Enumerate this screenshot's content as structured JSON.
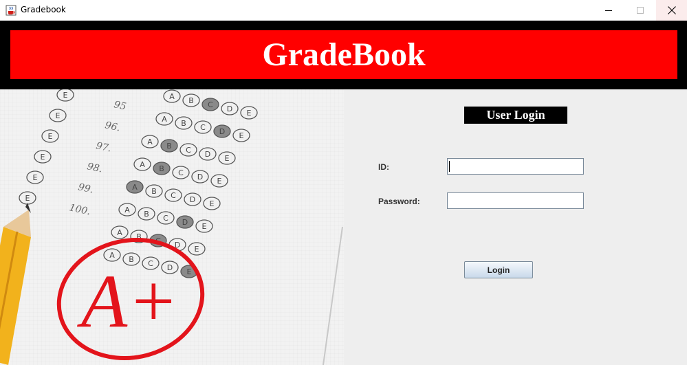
{
  "window": {
    "title": "Gradebook",
    "close_hover_color": "#fbecec"
  },
  "header": {
    "title": "GradeBook",
    "background": "#000000",
    "banner_color": "#ff0000"
  },
  "illustration": {
    "row_numbers": [
      "95",
      "96.",
      "97.",
      "98.",
      "99.",
      "100."
    ],
    "bubble_letters": [
      "A",
      "B",
      "C",
      "D",
      "E"
    ],
    "grade_mark": "A+"
  },
  "login": {
    "heading": "User Login",
    "id_label": "ID:",
    "id_value": "",
    "password_label": "Password:",
    "password_value": "",
    "button_label": "Login"
  },
  "icons": {
    "app": "java-coffee-icon",
    "minimize": "minimize-icon",
    "maximize": "maximize-icon",
    "close": "close-icon"
  }
}
